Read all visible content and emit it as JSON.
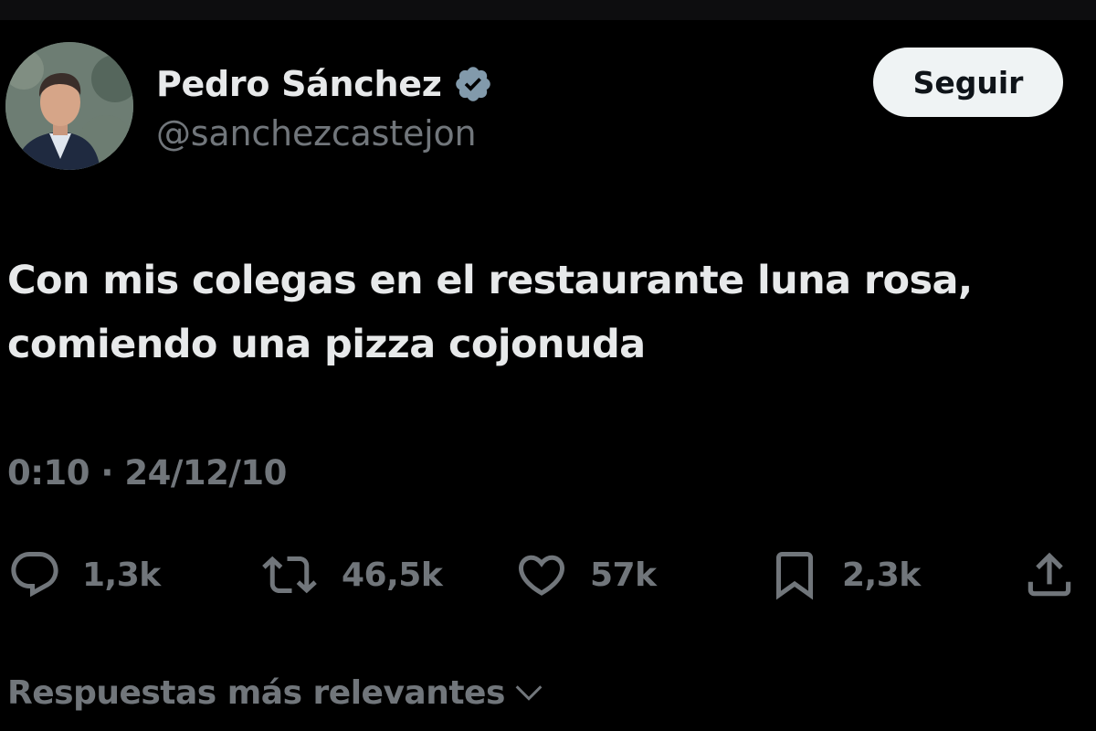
{
  "author": {
    "display_name": "Pedro Sánchez",
    "handle": "@sanchezcastejon",
    "avatar_icon": "profile-photo",
    "verified_icon": "verified-badge-icon"
  },
  "follow_button": {
    "label": "Seguir"
  },
  "tweet": {
    "text_line1": "Con mis colegas en el restaurante luna rosa,",
    "text_line2": "comiendo una pizza cojonuda",
    "timestamp": "0:10 · 24/12/10"
  },
  "actions": {
    "reply": {
      "icon": "reply-icon",
      "count": "1,3k"
    },
    "repost": {
      "icon": "repost-icon",
      "count": "46,5k"
    },
    "like": {
      "icon": "heart-icon",
      "count": "57k"
    },
    "bookmark": {
      "icon": "bookmark-icon",
      "count": "2,3k"
    },
    "share": {
      "icon": "share-icon"
    }
  },
  "replies_sort": {
    "label": "Respuestas más relevantes",
    "icon": "chevron-down-icon"
  },
  "colors": {
    "background": "#000000",
    "text_primary": "#e7e9ea",
    "text_secondary": "#71767b",
    "verified_badge": "#829aab",
    "follow_button_bg": "#eff3f4"
  }
}
